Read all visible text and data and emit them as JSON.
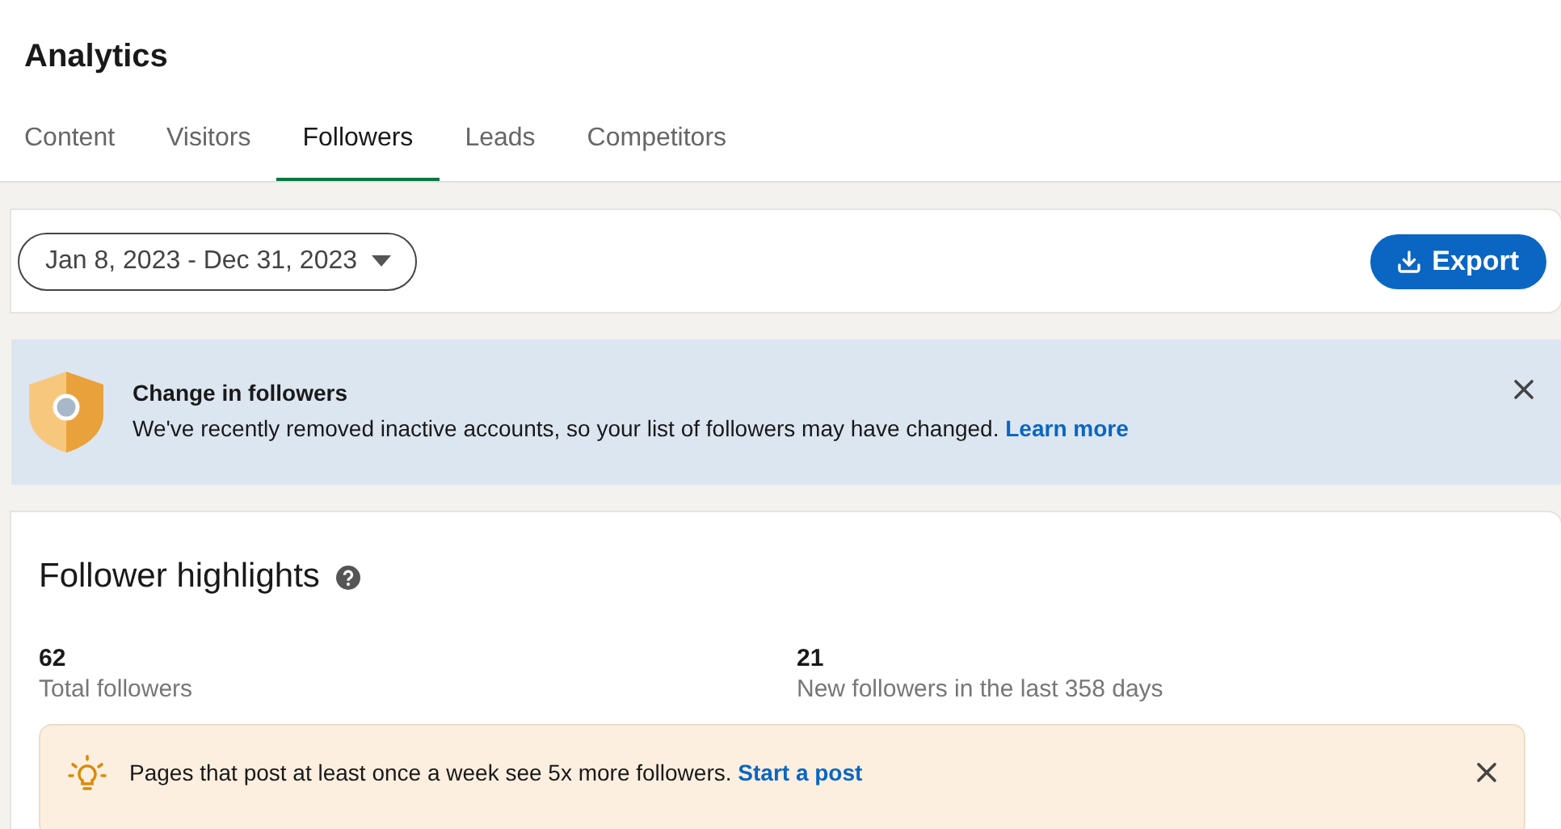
{
  "page_title": "Analytics",
  "tabs": [
    {
      "label": "Content",
      "selected": false
    },
    {
      "label": "Visitors",
      "selected": false
    },
    {
      "label": "Followers",
      "selected": true
    },
    {
      "label": "Leads",
      "selected": false
    },
    {
      "label": "Competitors",
      "selected": false
    }
  ],
  "date_range": "Jan 8, 2023 - Dec 31, 2023",
  "export_button": "Export",
  "notice": {
    "title": "Change in followers",
    "text": "We've recently removed inactive accounts, so your list of followers may have changed.",
    "link": "Learn more"
  },
  "highlights": {
    "title": "Follower highlights",
    "stats": [
      {
        "value": "62",
        "label": "Total followers"
      },
      {
        "value": "21",
        "label": "New followers in the last 358 days"
      }
    ],
    "tip": {
      "text": "Pages that post at least once a week see 5x more followers.",
      "link": "Start a post"
    }
  }
}
